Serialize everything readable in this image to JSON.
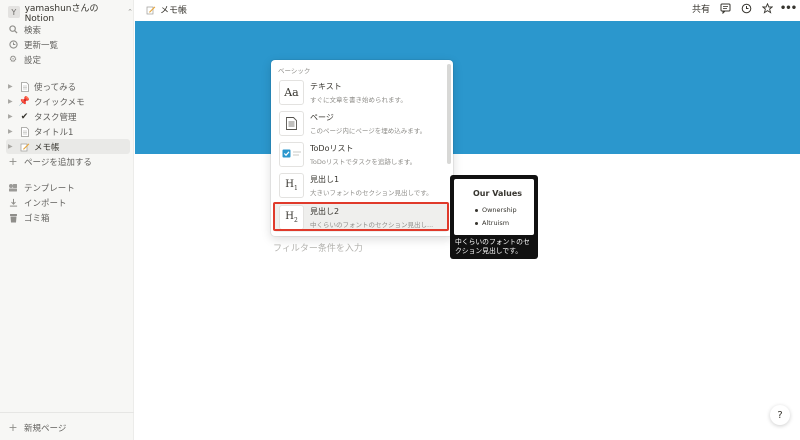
{
  "workspace": {
    "initial": "Y",
    "name": "yamashunさんのNotion"
  },
  "sidebar": {
    "nav": [
      {
        "label": "検索",
        "icon": "search-icon"
      },
      {
        "label": "更新一覧",
        "icon": "clock-icon"
      },
      {
        "label": "設定",
        "icon": "gear-icon"
      }
    ],
    "pages": [
      {
        "label": "使ってみる",
        "icon": "page-icon"
      },
      {
        "label": "クイックメモ",
        "icon": "pushpin-icon"
      },
      {
        "label": "タスク管理",
        "icon": "checkmark-icon"
      },
      {
        "label": "タイトル1",
        "icon": "page-icon"
      },
      {
        "label": "メモ帳",
        "icon": "memo-icon"
      }
    ],
    "add_page": "ページを追加する",
    "tools": [
      {
        "label": "テンプレート",
        "icon": "template-icon"
      },
      {
        "label": "インポート",
        "icon": "import-icon"
      },
      {
        "label": "ゴミ箱",
        "icon": "trash-icon"
      }
    ],
    "new_page": "新規ページ"
  },
  "topbar": {
    "breadcrumb": "メモ帳",
    "share": "共有"
  },
  "colors": {
    "cover": "#2b97cd",
    "highlight": "#e03a2b"
  },
  "filter_placeholder": "フィルター条件を入力",
  "block_menu": {
    "section": "ベーシック",
    "items": [
      {
        "title": "テキスト",
        "desc": "すぐに文章を書き始められます。"
      },
      {
        "title": "ページ",
        "desc": "このページ内にページを埋め込みます。"
      },
      {
        "title": "ToDoリスト",
        "desc": "ToDoリストでタスクを追跡します。"
      },
      {
        "title": "見出し1",
        "desc": "大きいフォントのセクション見出しです。"
      },
      {
        "title": "見出し2",
        "desc": "中くらいのフォントのセクション見出し..."
      }
    ],
    "selected_index": 4
  },
  "preview": {
    "title": "Our Values",
    "bullets": [
      "Ownership",
      "Altruism"
    ],
    "caption": "中くらいのフォントのセクション見出しです。"
  },
  "help": "?"
}
